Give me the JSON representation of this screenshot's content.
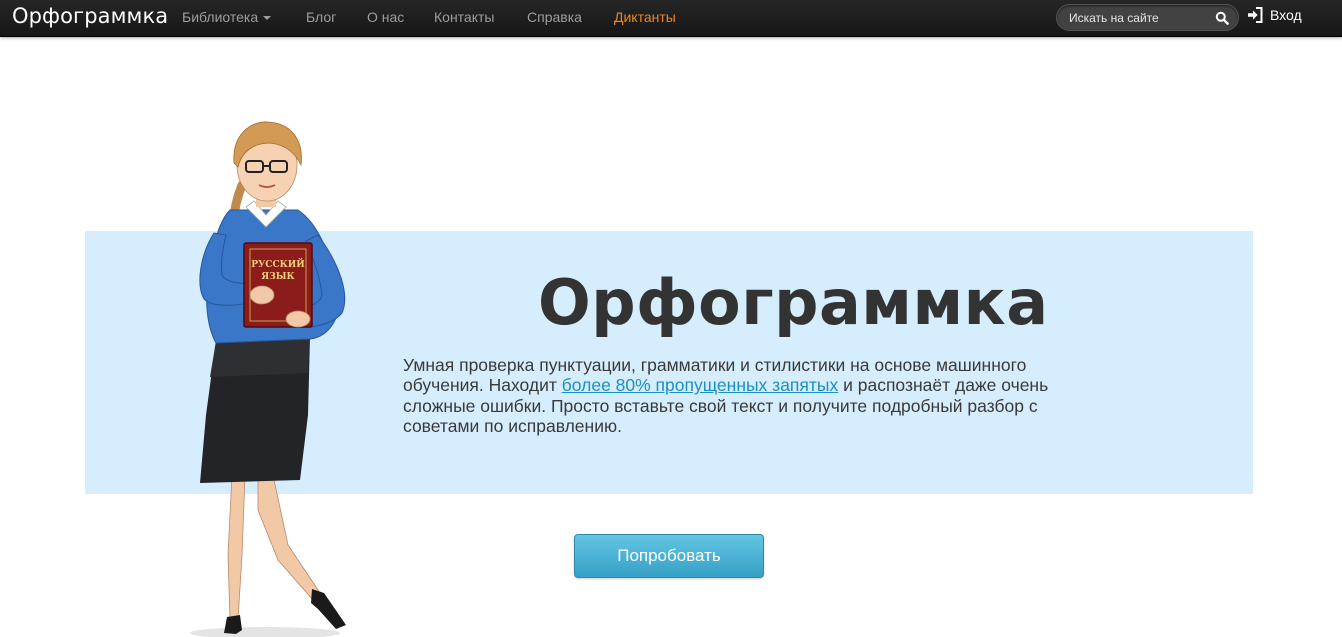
{
  "navbar": {
    "brand": "Орфограммка",
    "items": [
      {
        "label": "Библиотека",
        "dropdown": true
      },
      {
        "label": "Блог"
      },
      {
        "label": "О нас"
      },
      {
        "label": "Контакты"
      },
      {
        "label": "Справка"
      },
      {
        "label": "Диктанты",
        "active": true
      }
    ],
    "search": {
      "placeholder": "Искать на сайте"
    },
    "login_label": "Вход"
  },
  "hero": {
    "title": "Орфограммка",
    "text_before": "Умная проверка пунктуации, грамматики и стилистики на основе машинного обучения. Находит ",
    "link_text": "более 80% пропущенных запятых",
    "text_after": " и распознаёт даже очень сложные ошибки. Просто вставьте свой текст и получите подробный разбор с советами по исправлению.",
    "book_text": "РУССКИЙ ЯЗЫК"
  },
  "cta": {
    "label": "Попробовать"
  },
  "colors": {
    "navbar_bg": "#1e1e1e",
    "nav_text": "#9d9d9d",
    "nav_active": "#f0861c",
    "hero_bg": "#d5edfd",
    "link": "#1b8fc4",
    "button": "#45aed3"
  },
  "icons": {
    "search": "magnifier-icon",
    "login": "sign-in-icon",
    "dropdown": "caret-down-icon"
  }
}
